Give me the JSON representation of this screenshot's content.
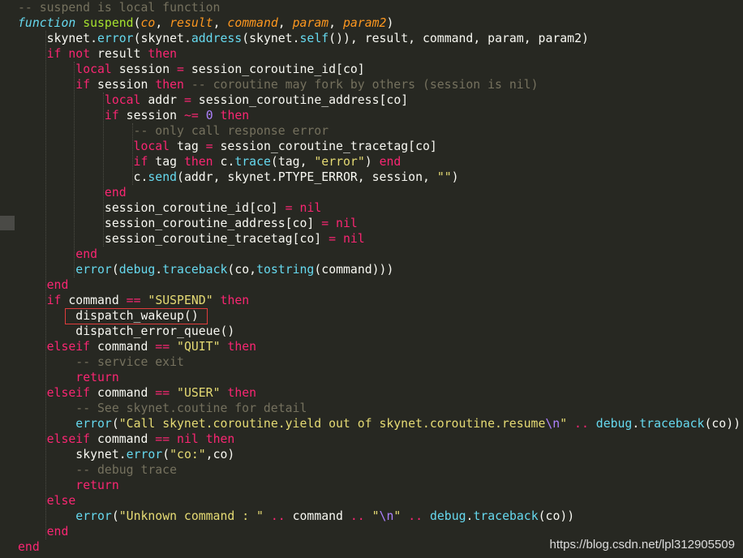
{
  "editor": {
    "theme": "monokai",
    "colors": {
      "background": "#272822",
      "keyword": "#f92672",
      "builtin": "#66d9ef",
      "function_name": "#a6e22e",
      "parameter": "#fd971f",
      "string": "#e6db74",
      "number": "#ae81ff",
      "comment": "#75715e",
      "text": "#f8f8f2",
      "highlight_box": "#e03c3c"
    },
    "lines": [
      "-- suspend is local function",
      "function suspend(co, result, command, param, param2)",
      "    skynet.error(skynet.address(skynet.self()), result, command, param, param2)",
      "    if not result then",
      "        local session = session_coroutine_id[co]",
      "        if session then -- coroutine may fork by others (session is nil)",
      "            local addr = session_coroutine_address[co]",
      "            if session ~= 0 then",
      "                -- only call response error",
      "                local tag = session_coroutine_tracetag[co]",
      "                if tag then c.trace(tag, \"error\") end",
      "                c.send(addr, skynet.PTYPE_ERROR, session, \"\")",
      "            end",
      "            session_coroutine_id[co] = nil",
      "            session_coroutine_address[co] = nil",
      "            session_coroutine_tracetag[co] = nil",
      "        end",
      "        error(debug.traceback(co,tostring(command)))",
      "    end",
      "    if command == \"SUSPEND\" then",
      "        dispatch_wakeup()",
      "        dispatch_error_queue()",
      "    elseif command == \"QUIT\" then",
      "        -- service exit",
      "        return",
      "    elseif command == \"USER\" then",
      "        -- See skynet.coutine for detail",
      "        error(\"Call skynet.coroutine.yield out of skynet.coroutine.resume\\n\" .. debug.traceback(co))",
      "    elseif command == nil then",
      "        skynet.error(\"co:\",co)",
      "        -- debug trace",
      "        return",
      "    else",
      "        error(\"Unknown command : \" .. command .. \"\\n\" .. debug.traceback(co))",
      "    end",
      "end"
    ],
    "highlighted_line": 20
  },
  "watermark": "https://blog.csdn.net/lpl312905509"
}
